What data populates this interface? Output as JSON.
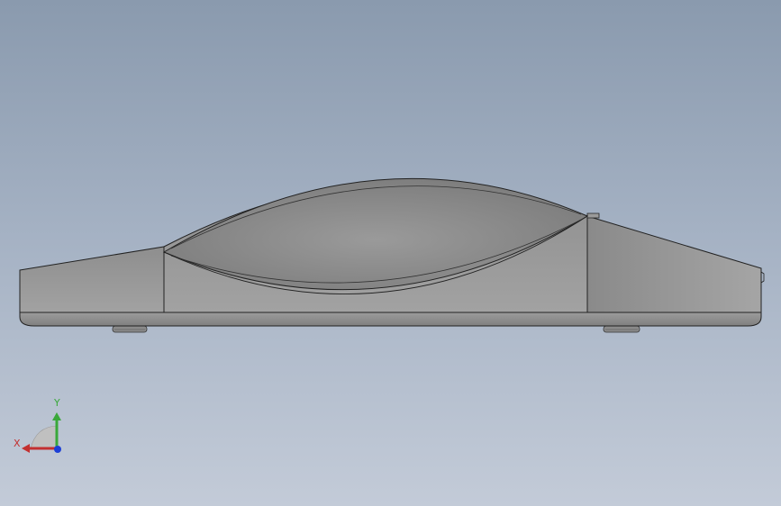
{
  "viewport": {
    "background_top": "#8a9aae",
    "background_bottom": "#c3cbd8",
    "model_color": "#8f8f8f",
    "edge_color": "#222222"
  },
  "triad": {
    "x_label": "X",
    "y_label": "Y",
    "x_color": "#c33030",
    "y_color": "#3aa83a",
    "z_color": "#1c3fd6"
  }
}
